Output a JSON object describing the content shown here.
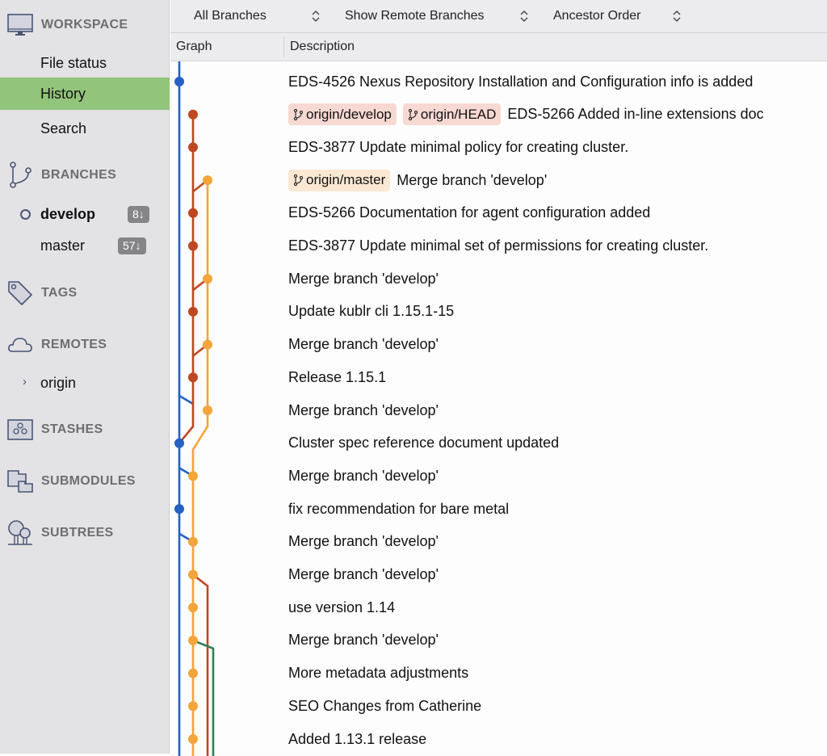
{
  "sidebar": {
    "workspace": {
      "label": "WORKSPACE",
      "items": [
        {
          "label": "File status"
        },
        {
          "label": "History",
          "active": true
        },
        {
          "label": "Search"
        }
      ]
    },
    "branches": {
      "label": "BRANCHES",
      "items": [
        {
          "label": "develop",
          "current": true,
          "badge": "8↓"
        },
        {
          "label": "master",
          "badge": "57↓"
        }
      ]
    },
    "tags": {
      "label": "TAGS"
    },
    "remotes": {
      "label": "REMOTES",
      "items": [
        {
          "label": "origin",
          "expand_icon": "chevron-right-icon"
        }
      ]
    },
    "stashes": {
      "label": "STASHES"
    },
    "submodules": {
      "label": "SUBMODULES"
    },
    "subtrees": {
      "label": "SUBTREES"
    }
  },
  "toolbar": {
    "branch_filter": "All Branches",
    "remote_filter": "Show Remote Branches",
    "order": "Ancestor Order"
  },
  "columns": {
    "graph": "Graph",
    "description": "Description"
  },
  "colors": {
    "blue": "#2561c4",
    "red": "#bf4722",
    "orange": "#f3a53a",
    "green": "#327e57",
    "active_item": "#92c47b"
  },
  "commits": [
    {
      "description": "EDS-4526 Nexus Repository Installation and Configuration info is added",
      "lane": 0,
      "color": "blue",
      "tags": []
    },
    {
      "description": "EDS-5266 Added in-line extensions doc",
      "lane": 1,
      "color": "red",
      "tags": [
        {
          "label": "origin/develop",
          "style": "red"
        },
        {
          "label": "origin/HEAD",
          "style": "red"
        }
      ]
    },
    {
      "description": "EDS-3877 Update minimal policy for creating cluster.",
      "lane": 1,
      "color": "red",
      "tags": []
    },
    {
      "description": "Merge branch 'develop'",
      "lane": 2,
      "color": "orange",
      "tags": [
        {
          "label": "origin/master",
          "style": "orange"
        }
      ]
    },
    {
      "description": "EDS-5266 Documentation for agent configuration added",
      "lane": 1,
      "color": "red",
      "tags": []
    },
    {
      "description": "EDS-3877 Update minimal set of permissions for creating cluster.",
      "lane": 1,
      "color": "red",
      "tags": []
    },
    {
      "description": "Merge branch 'develop'",
      "lane": 2,
      "color": "orange",
      "tags": []
    },
    {
      "description": "Update kublr cli  1.15.1-15",
      "lane": 1,
      "color": "red",
      "tags": []
    },
    {
      "description": "Merge branch 'develop'",
      "lane": 2,
      "color": "orange",
      "tags": []
    },
    {
      "description": "Release 1.15.1",
      "lane": 1,
      "color": "red",
      "tags": []
    },
    {
      "description": "Merge branch 'develop'",
      "lane": 2,
      "color": "orange",
      "tags": []
    },
    {
      "description": "Cluster spec reference document updated",
      "lane": 0,
      "color": "blue",
      "tags": []
    },
    {
      "description": "Merge branch 'develop'",
      "lane": 1,
      "color": "orange",
      "tags": []
    },
    {
      "description": "fix recommendation for bare metal",
      "lane": 0,
      "color": "blue",
      "tags": []
    },
    {
      "description": "Merge branch 'develop'",
      "lane": 1,
      "color": "orange",
      "tags": []
    },
    {
      "description": "Merge branch 'develop'",
      "lane": 1,
      "color": "orange",
      "tags": []
    },
    {
      "description": "use version 1.14",
      "lane": 1,
      "color": "orange",
      "tags": []
    },
    {
      "description": "Merge branch 'develop'",
      "lane": 1,
      "color": "orange",
      "tags": []
    },
    {
      "description": "More metadata adjustments",
      "lane": 1,
      "color": "orange",
      "tags": []
    },
    {
      "description": "SEO Changes from Catherine",
      "lane": 1,
      "color": "orange",
      "tags": []
    },
    {
      "description": "Added 1.13.1 release",
      "lane": 1,
      "color": "orange",
      "tags": []
    }
  ]
}
